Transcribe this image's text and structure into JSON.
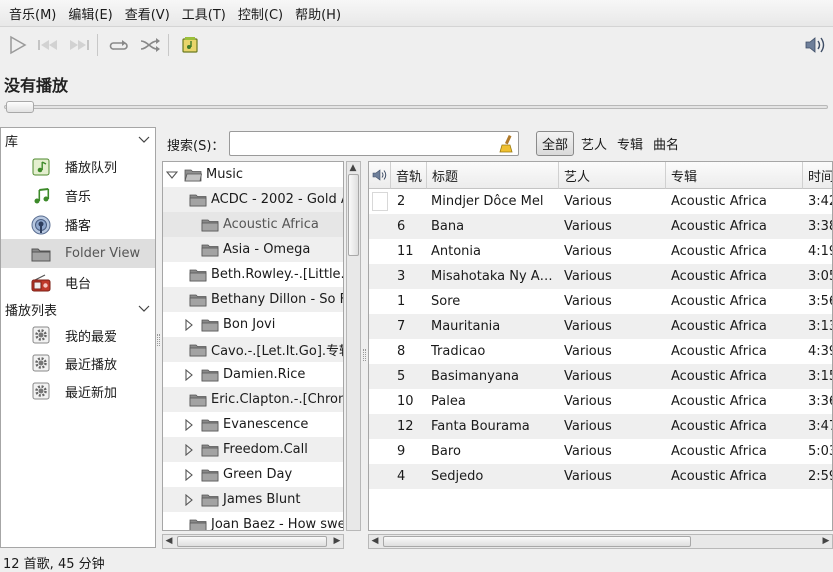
{
  "menu": [
    "音乐(M)",
    "编辑(E)",
    "查看(V)",
    "工具(T)",
    "控制(C)",
    "帮助(H)"
  ],
  "now_playing": "没有播放",
  "sidebar": {
    "library_header": "库",
    "library_items": [
      {
        "label": "播放队列",
        "icon": "play-queue-icon"
      },
      {
        "label": "音乐",
        "icon": "music-note-icon"
      },
      {
        "label": "播客",
        "icon": "podcast-icon"
      },
      {
        "label": "Folder View",
        "icon": "folder-icon"
      },
      {
        "label": "电台",
        "icon": "radio-icon"
      }
    ],
    "playlist_header": "播放列表",
    "playlist_items": [
      {
        "label": "我的最爱",
        "icon": "gear-playlist-icon"
      },
      {
        "label": "最近播放",
        "icon": "gear-playlist-icon"
      },
      {
        "label": "最近新加",
        "icon": "gear-playlist-icon"
      }
    ]
  },
  "search": {
    "label": "搜索(S)：",
    "value": ""
  },
  "filters": [
    "全部",
    "艺人",
    "专辑",
    "曲名"
  ],
  "folder_tree": {
    "root": "Music",
    "items": [
      {
        "label": "ACDC - 2002 - Gold A",
        "expander": false
      },
      {
        "label": "Acoustic Africa",
        "expander": false
      },
      {
        "label": "Asia - Omega",
        "expander": false
      },
      {
        "label": "Beth.Rowley.-.[Little.",
        "expander": false
      },
      {
        "label": "Bethany Dillon - So Fa",
        "expander": false
      },
      {
        "label": "Bon Jovi",
        "expander": true
      },
      {
        "label": "Cavo.-.[Let.It.Go].专辑",
        "expander": false
      },
      {
        "label": "Damien.Rice",
        "expander": true
      },
      {
        "label": "Eric.Clapton.-.[Chroni",
        "expander": false
      },
      {
        "label": "Evanescence",
        "expander": true
      },
      {
        "label": "Freedom.Call",
        "expander": true
      },
      {
        "label": "Green Day",
        "expander": true
      },
      {
        "label": "James Blunt",
        "expander": true
      },
      {
        "label": "Joan Baez - How swe",
        "expander": false
      }
    ]
  },
  "track_list": {
    "columns": [
      "音轨",
      "标题",
      "艺人",
      "专辑",
      "时间"
    ],
    "rows": [
      {
        "track": "2",
        "title": "Mindjer Dôce Mel",
        "artist": "Various",
        "album": "Acoustic Africa",
        "time": "3:42"
      },
      {
        "track": "6",
        "title": "Bana",
        "artist": "Various",
        "album": "Acoustic Africa",
        "time": "3:38"
      },
      {
        "track": "11",
        "title": "Antonia",
        "artist": "Various",
        "album": "Acoustic Africa",
        "time": "4:19"
      },
      {
        "track": "3",
        "title": "Misahotaka Ny Aka…",
        "artist": "Various",
        "album": "Acoustic Africa",
        "time": "3:05"
      },
      {
        "track": "1",
        "title": "Sore",
        "artist": "Various",
        "album": "Acoustic Africa",
        "time": "3:56"
      },
      {
        "track": "7",
        "title": "Mauritania",
        "artist": "Various",
        "album": "Acoustic Africa",
        "time": "3:13"
      },
      {
        "track": "8",
        "title": "Tradicao",
        "artist": "Various",
        "album": "Acoustic Africa",
        "time": "4:39"
      },
      {
        "track": "5",
        "title": "Basimanyana",
        "artist": "Various",
        "album": "Acoustic Africa",
        "time": "3:15"
      },
      {
        "track": "10",
        "title": "Palea",
        "artist": "Various",
        "album": "Acoustic Africa",
        "time": "3:36"
      },
      {
        "track": "12",
        "title": "Fanta Bourama",
        "artist": "Various",
        "album": "Acoustic Africa",
        "time": "3:47"
      },
      {
        "track": "9",
        "title": "Baro",
        "artist": "Various",
        "album": "Acoustic Africa",
        "time": "5:03"
      },
      {
        "track": "4",
        "title": "Sedjedo",
        "artist": "Various",
        "album": "Acoustic Africa",
        "time": "2:59"
      }
    ]
  },
  "status": "12 首歌, 45 分钟",
  "colors": {
    "accent_green": "#3d8a2a",
    "selection_gray": "#dedede",
    "radio_red": "#c0392b"
  }
}
